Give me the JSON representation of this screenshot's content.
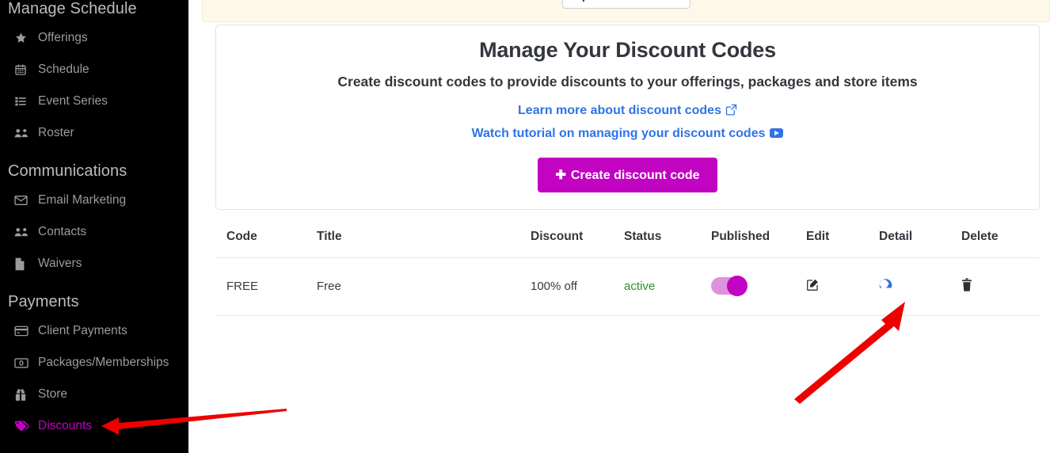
{
  "sidebar": {
    "sections": [
      {
        "heading": "Manage Schedule",
        "items": [
          {
            "label": "Offerings",
            "icon": "star-icon",
            "active": false
          },
          {
            "label": "Schedule",
            "icon": "calendar-icon",
            "active": false
          },
          {
            "label": "Event Series",
            "icon": "list-icon",
            "active": false
          },
          {
            "label": "Roster",
            "icon": "users-icon",
            "active": false
          }
        ]
      },
      {
        "heading": "Communications",
        "items": [
          {
            "label": "Email Marketing",
            "icon": "envelope-icon",
            "active": false
          },
          {
            "label": "Contacts",
            "icon": "users-icon",
            "active": false
          },
          {
            "label": "Waivers",
            "icon": "file-icon",
            "active": false
          }
        ]
      },
      {
        "heading": "Payments",
        "items": [
          {
            "label": "Client Payments",
            "icon": "credit-card-icon",
            "active": false
          },
          {
            "label": "Packages/Memberships",
            "icon": "money-bill-icon",
            "active": false
          },
          {
            "label": "Store",
            "icon": "gift-icon",
            "active": false
          },
          {
            "label": "Discounts",
            "icon": "tags-icon",
            "active": true
          }
        ]
      }
    ],
    "active_color": "#c203c2"
  },
  "banner": {
    "update_card_label": "Update Credit Card",
    "background": "#fdf8e7"
  },
  "card": {
    "title": "Manage Your Discount Codes",
    "subtitle": "Create discount codes to provide discounts to your offerings, packages and store items",
    "learn_more_link": "Learn more about discount codes",
    "tutorial_link": "Watch tutorial on managing your discount codes",
    "create_button": "Create discount code",
    "create_button_plus": "✚",
    "accent_color": "#c203c2",
    "link_color": "#2f73e8"
  },
  "table": {
    "headers": [
      "Code",
      "Title",
      "Discount",
      "Status",
      "Published",
      "Edit",
      "Detail",
      "Delete"
    ],
    "rows": [
      {
        "code": "FREE",
        "title": "Free",
        "discount": "100% off",
        "status": "active",
        "status_color": "#2a8f2a",
        "published": true,
        "edit_icon": "pencil-square-icon",
        "detail_icon": "tachometer-icon",
        "delete_icon": "trash-icon"
      }
    ]
  },
  "annotations": {
    "arrow_color": "#ee0000",
    "arrows": [
      {
        "name": "arrow-to-discounts",
        "points_at": "Discounts"
      },
      {
        "name": "arrow-to-detail-icon",
        "points_at": "Detail"
      }
    ]
  }
}
